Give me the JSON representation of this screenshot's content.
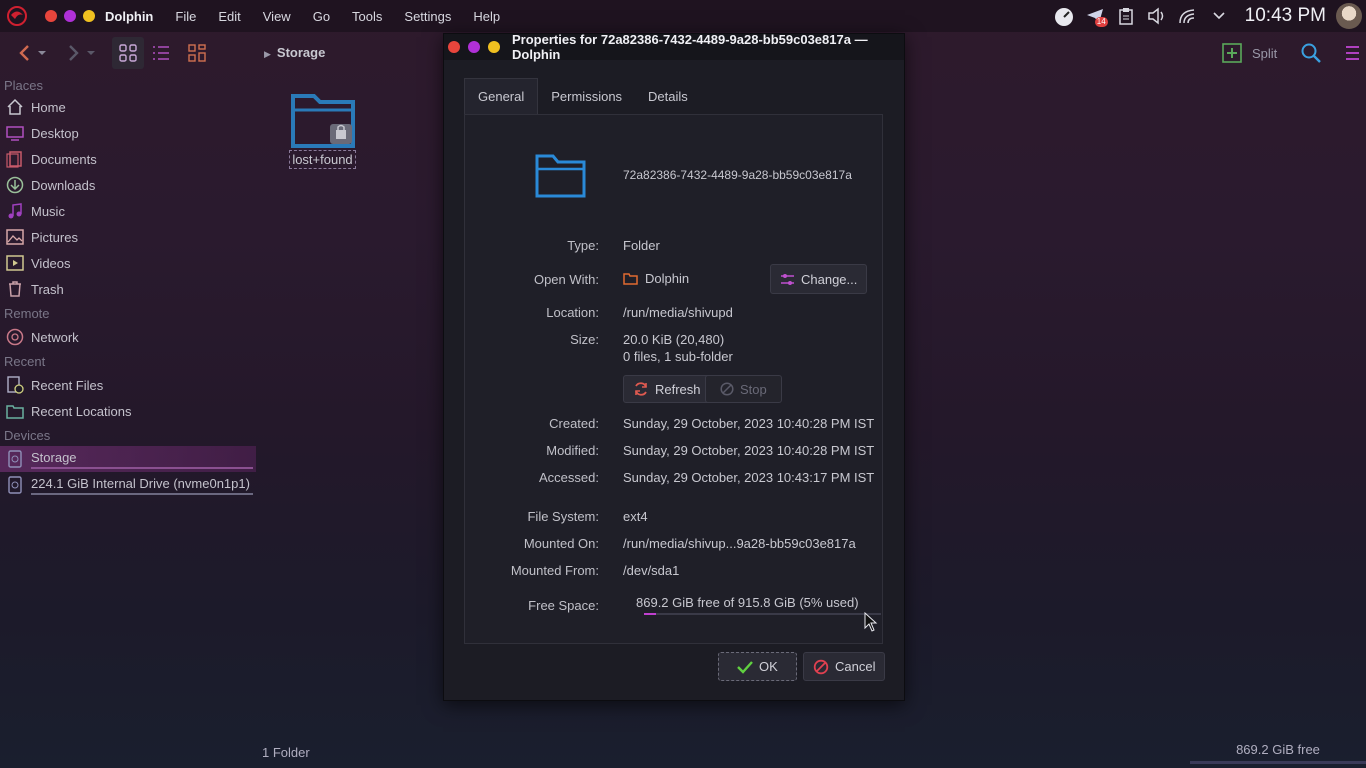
{
  "topbar": {
    "menu": [
      "Dolphin",
      "File",
      "Edit",
      "View",
      "Go",
      "Tools",
      "Settings",
      "Help"
    ],
    "update_badge": "14",
    "clock": "10:43 PM"
  },
  "toolbar": {
    "breadcrumb": "Storage",
    "split_label": "Split"
  },
  "sidebar": {
    "places_header": "Places",
    "places": [
      "Home",
      "Desktop",
      "Documents",
      "Downloads",
      "Music",
      "Pictures",
      "Videos",
      "Trash"
    ],
    "remote_header": "Remote",
    "remote": [
      "Network"
    ],
    "recent_header": "Recent",
    "recent": [
      "Recent Files",
      "Recent Locations"
    ],
    "devices_header": "Devices",
    "devices": [
      "Storage",
      "224.1 GiB Internal Drive (nvme0n1p1)"
    ]
  },
  "content": {
    "folder_name": "lost+found",
    "status_left": "1 Folder",
    "status_right": "869.2 GiB free"
  },
  "dialog": {
    "title": "Properties for 72a82386-7432-4489-9a28-bb59c03e817a — Dolphin",
    "tabs": [
      "General",
      "Permissions",
      "Details"
    ],
    "name": "72a82386-7432-4489-9a28-bb59c03e817a",
    "type_label": "Type:",
    "type_value": "Folder",
    "open_with_label": "Open With:",
    "open_with_value": "Dolphin",
    "change_button": "Change...",
    "location_label": "Location:",
    "location_value": "/run/media/shivupd",
    "size_label": "Size:",
    "size_value": "20.0 KiB (20,480)",
    "size_count": "0 files, 1 sub-folder",
    "refresh_button": "Refresh",
    "stop_button": "Stop",
    "created_label": "Created:",
    "created_value": "Sunday, 29 October, 2023 10:40:28 PM IST",
    "modified_label": "Modified:",
    "modified_value": "Sunday, 29 October, 2023 10:40:28 PM IST",
    "accessed_label": "Accessed:",
    "accessed_value": "Sunday, 29 October, 2023 10:43:17 PM IST",
    "fs_label": "File System:",
    "fs_value": "ext4",
    "mounted_on_label": "Mounted On:",
    "mounted_on_value": "/run/media/shivup...9a28-bb59c03e817a",
    "mounted_from_label": "Mounted From:",
    "mounted_from_value": "/dev/sda1",
    "free_space_label": "Free Space:",
    "free_space_value": "869.2 GiB free of 915.8 GiB (5% used)",
    "used_fraction": 0.05,
    "ok_button": "OK",
    "cancel_button": "Cancel"
  },
  "colors": {
    "accent": "#c040d0",
    "folder_blue": "#2a8ad8",
    "close": "#e8453c",
    "minimize": "#b030d8",
    "maximize": "#f0c020"
  }
}
